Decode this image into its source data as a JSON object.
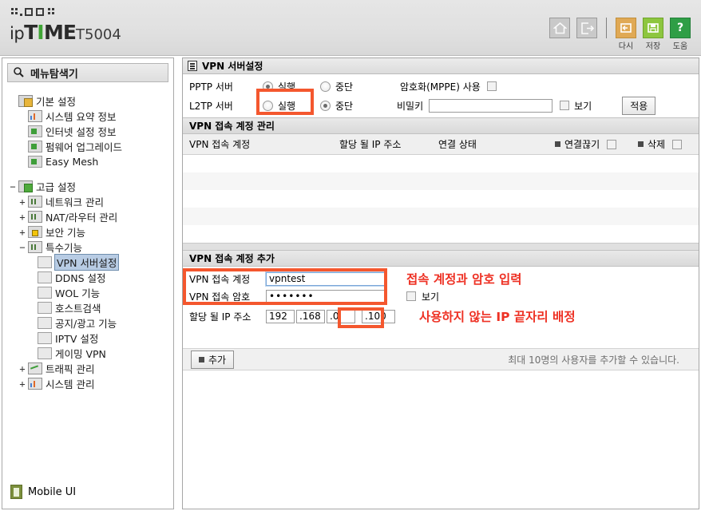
{
  "header": {
    "brand_ip": "ip",
    "brand_t": "T",
    "brand_i": "I",
    "brand_me": "ME",
    "model": "T5004",
    "toolbar": [
      {
        "name": "home-icon",
        "label": ""
      },
      {
        "name": "logout-icon",
        "label": ""
      },
      {
        "name": "refresh-icon",
        "label": "다시"
      },
      {
        "name": "save-icon",
        "label": "저장"
      },
      {
        "name": "help-icon",
        "label": "도움"
      }
    ]
  },
  "sidebar": {
    "title": "메뉴탐색기",
    "nodes": [
      {
        "label": "기본 설정",
        "level": 0,
        "pm": "",
        "icon": "folder-orange-icon"
      },
      {
        "label": "시스템 요약 정보",
        "level": 1,
        "pm": "",
        "icon": "chart-icon"
      },
      {
        "label": "인터넷 설정 정보",
        "level": 1,
        "pm": "",
        "icon": "monitor-icon"
      },
      {
        "label": "펌웨어 업그레이드",
        "level": 1,
        "pm": "",
        "icon": "upload-icon"
      },
      {
        "label": "Easy Mesh",
        "level": 1,
        "pm": "",
        "icon": "mesh-icon"
      },
      {
        "label": "고급 설정",
        "level": 0,
        "pm": "−",
        "icon": "folder-green-icon"
      },
      {
        "label": "네트워크 관리",
        "level": 1,
        "pm": "+",
        "icon": "network-icon"
      },
      {
        "label": "NAT/라우터 관리",
        "level": 1,
        "pm": "+",
        "icon": "router-icon"
      },
      {
        "label": "보안 기능",
        "level": 1,
        "pm": "+",
        "icon": "lock-icon"
      },
      {
        "label": "특수기능",
        "level": 1,
        "pm": "−",
        "icon": "grid-icon"
      },
      {
        "label": "VPN 서버설정",
        "level": 2,
        "pm": "",
        "icon": "page-icon",
        "selected": true
      },
      {
        "label": "DDNS 설정",
        "level": 2,
        "pm": "",
        "icon": "page-icon"
      },
      {
        "label": "WOL 기능",
        "level": 2,
        "pm": "",
        "icon": "page-icon"
      },
      {
        "label": "호스트검색",
        "level": 2,
        "pm": "",
        "icon": "page-icon"
      },
      {
        "label": "공지/광고 기능",
        "level": 2,
        "pm": "",
        "icon": "page-icon"
      },
      {
        "label": "IPTV 설정",
        "level": 2,
        "pm": "",
        "icon": "page-icon"
      },
      {
        "label": "게이밍 VPN",
        "level": 2,
        "pm": "",
        "icon": "page-icon"
      },
      {
        "label": "트래픽 관리",
        "level": 1,
        "pm": "+",
        "icon": "traffic-icon"
      },
      {
        "label": "시스템 관리",
        "level": 1,
        "pm": "+",
        "icon": "system-icon"
      }
    ],
    "mobile_ui": "Mobile UI"
  },
  "main": {
    "panel_title": "VPN 서버설정",
    "server_settings": {
      "pptp_label": "PPTP 서버",
      "l2tp_label": "L2TP 서버",
      "run_label": "실행",
      "stop_label": "중단",
      "pptp_selected": "실행",
      "l2tp_selected": "중단",
      "mppe_label": "암호화(MPPE) 사용",
      "mppe_checked": false,
      "secret_label": "비밀키",
      "secret_value": "",
      "show_label": "보기",
      "apply_label": "적용"
    },
    "account_mgmt": {
      "section_title": "VPN 접속 계정 관리",
      "columns": [
        "VPN 접속 계정",
        "할당 될 IP 주소",
        "연결 상태",
        "연결끊기",
        "삭제"
      ],
      "rows": []
    },
    "account_add": {
      "section_title": "VPN 접속 계정 추가",
      "account_label": "VPN 접속 계정",
      "account_value": "vpntest",
      "password_label": "VPN 접속 암호",
      "password_value": "•••••••",
      "show_label": "보기",
      "ip_label": "할당 될 IP 주소",
      "ip_o1": "192",
      "ip_o2": ".168",
      "ip_o3": ".0",
      "ip_o4": ".100",
      "add_button": "추가",
      "footnote": "최대 10명의 사용자를 추가할 수 있습니다."
    },
    "annotations": [
      {
        "text": "접속 계정과 암호 입력"
      },
      {
        "text": "사용하지 않는 IP 끝자리 배정"
      }
    ],
    "highlight_color": "#f4572e"
  }
}
